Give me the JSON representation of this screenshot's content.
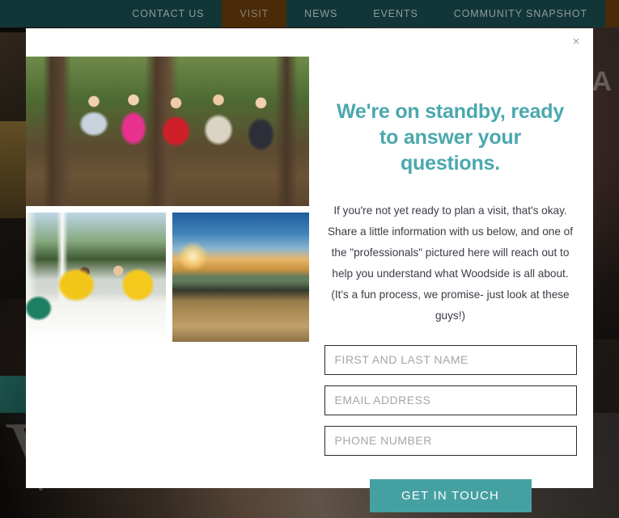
{
  "nav": {
    "items": [
      {
        "label": "CONTACT US",
        "active": false
      },
      {
        "label": "VISIT",
        "active": true
      },
      {
        "label": "NEWS",
        "active": false
      },
      {
        "label": "EVENTS",
        "active": false
      },
      {
        "label": "COMMUNITY SNAPSHOT",
        "active": false
      }
    ],
    "bar_color": "#123637",
    "active_color": "#4a2a07"
  },
  "background": {
    "hero_word": "V",
    "hero_sub": "REA"
  },
  "modal": {
    "close_icon": "×",
    "title": "We're on standby, ready to answer your questions.",
    "body": "If you're not yet ready to plan a visit, that's okay. Share a little information with us below, and one of the \"professionals\" pictured here will reach out to help you understand what Woodside is all about. (It's a fun process, we promise- just look at these guys!)",
    "title_color": "#4aa8ad",
    "photos": [
      {
        "name": "group-costume-portrait",
        "alt": "Five people posing with costume props in a pine forest"
      },
      {
        "name": "poolside-gathering",
        "alt": "Group of friends with drinks at a white patio table by the pool"
      },
      {
        "name": "golf-course-sunset",
        "alt": "Golf course fairway and bunkers at sunset"
      }
    ],
    "form": {
      "fields": [
        {
          "name": "full-name",
          "placeholder": "FIRST AND LAST NAME",
          "value": ""
        },
        {
          "name": "email",
          "placeholder": "EMAIL ADDRESS",
          "value": ""
        },
        {
          "name": "phone",
          "placeholder": "PHONE NUMBER",
          "value": ""
        }
      ],
      "submit_label": "GET IN TOUCH",
      "submit_color": "#45a0a2"
    }
  }
}
